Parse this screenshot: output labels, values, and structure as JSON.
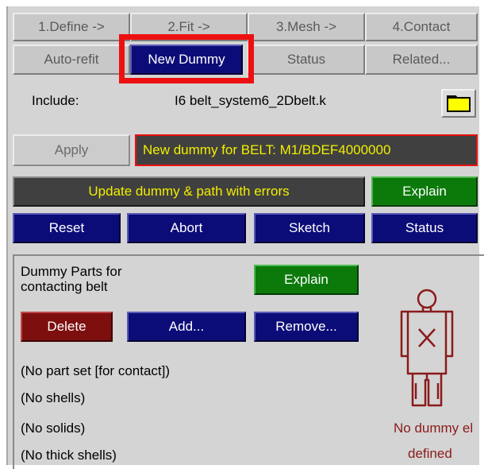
{
  "tabs": [
    {
      "label": "1.Define ->"
    },
    {
      "label": "2.Fit ->"
    },
    {
      "label": "3.Mesh ->"
    },
    {
      "label": "4.Contact"
    }
  ],
  "subtabs": [
    {
      "label": "Auto-refit"
    },
    {
      "label": "New Dummy"
    },
    {
      "label": "Status"
    },
    {
      "label": "Related..."
    }
  ],
  "include": {
    "label": "Include:",
    "value": "I6  belt_system6_2Dbelt.k",
    "folder_icon": "folder-icon"
  },
  "apply_label": "Apply",
  "message": "New dummy for BELT: M1/BDEF4000000",
  "update_label": "Update dummy & path with errors",
  "explain_label": "Explain",
  "actions": {
    "reset": "Reset",
    "abort": "Abort",
    "sketch": "Sketch",
    "status": "Status"
  },
  "parts": {
    "title_line1": "Dummy Parts for",
    "title_line2": "contacting belt",
    "explain": "Explain",
    "delete": "Delete",
    "add": "Add...",
    "remove": "Remove...",
    "info": [
      "(No part set [for contact])",
      "(No shells)",
      "(No solids)",
      "(No thick shells)"
    ],
    "dummy_icon": "dummy-figure-icon",
    "dummy_msg_line1": "No dummy el",
    "dummy_msg_line2": "defined"
  },
  "colors": {
    "panel": "#d4d4d4",
    "blue_button": "#0c0c78",
    "green_button": "#0b7a0b",
    "red_button": "#7e0f0f",
    "message_bg": "#404040",
    "message_text": "#f2ee00",
    "highlight": "#ee1010",
    "dummy": "#8b1a1a"
  }
}
